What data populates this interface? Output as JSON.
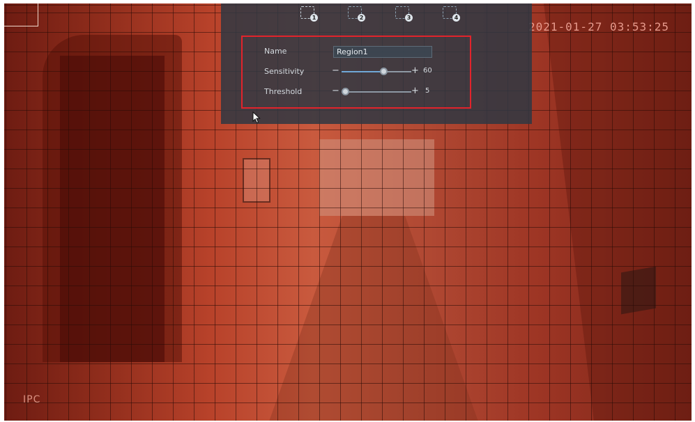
{
  "osd": {
    "timestamp": "2021-01-27 03:53:25",
    "camera_label": "IPC"
  },
  "region_tabs": [
    {
      "number": "1",
      "selected": true
    },
    {
      "number": "2",
      "selected": false
    },
    {
      "number": "3",
      "selected": false
    },
    {
      "number": "4",
      "selected": false
    }
  ],
  "region_settings": {
    "name_label": "Name",
    "name_value": "Region1",
    "sensitivity_label": "Sensitivity",
    "sensitivity_value": 60,
    "sensitivity_text": "60",
    "threshold_label": "Threshold",
    "threshold_value": 5,
    "threshold_text": "5",
    "slider_max": 100,
    "minus_symbol": "−",
    "plus_symbol": "+"
  },
  "colors": {
    "mask_red": "#c0422b",
    "highlight_border": "#e2232b",
    "panel_bg": "#303842"
  }
}
